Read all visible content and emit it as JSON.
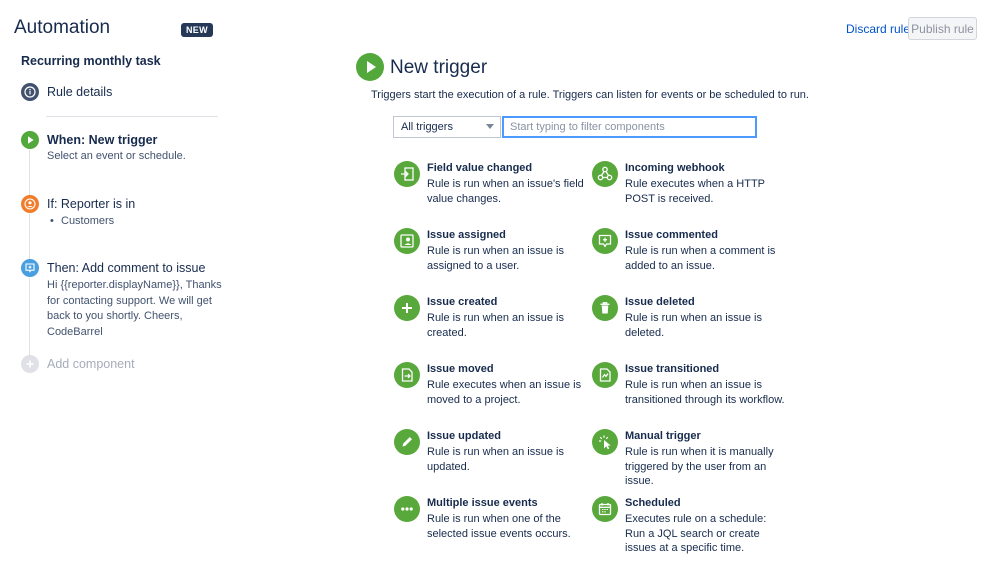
{
  "header": {
    "title": "Automation",
    "badge": "NEW",
    "discard_label": "Discard rule",
    "publish_label": "Publish rule"
  },
  "sidebar": {
    "rule_name": "Recurring monthly task",
    "rule_details_label": "Rule details",
    "steps": [
      {
        "title": "When: New trigger",
        "subtitle": "Select an event or schedule.",
        "color": "#52a83b",
        "icon": "play-icon"
      },
      {
        "title": "If: Reporter is in",
        "subtitle": "Customers",
        "color": "#f07d2b",
        "icon": "user-icon"
      },
      {
        "title": "Then: Add comment to issue",
        "subtitle": "Hi {{reporter.displayName}}, Thanks for contacting support. We will get back to you shortly. Cheers, CodeBarrel",
        "color": "#4a9fe0",
        "icon": "comment-icon"
      }
    ],
    "add_component_label": "Add component"
  },
  "main": {
    "title": "New trigger",
    "description": "Triggers start the execution of a rule. Triggers can listen for events or be scheduled to run.",
    "filter_select_value": "All triggers",
    "filter_placeholder": "Start typing to filter components",
    "components": [
      {
        "name": "Field value changed",
        "description": "Rule is run when an issue's field value changes.",
        "icon": "field-change-icon"
      },
      {
        "name": "Incoming webhook",
        "description": "Rule executes when a HTTP POST is received.",
        "icon": "webhook-icon"
      },
      {
        "name": "Issue assigned",
        "description": "Rule is run when an issue is assigned to a user.",
        "icon": "assign-user-icon"
      },
      {
        "name": "Issue commented",
        "description": "Rule is run when a comment is added to an issue.",
        "icon": "comment-icon"
      },
      {
        "name": "Issue created",
        "description": "Rule is run when an issue is created.",
        "icon": "plus-icon"
      },
      {
        "name": "Issue deleted",
        "description": "Rule is run when an issue is deleted.",
        "icon": "trash-icon"
      },
      {
        "name": "Issue moved",
        "description": "Rule executes when an issue is moved to a project.",
        "icon": "move-icon"
      },
      {
        "name": "Issue transitioned",
        "description": "Rule is run when an issue is transitioned through its workflow.",
        "icon": "transition-icon"
      },
      {
        "name": "Issue updated",
        "description": "Rule is run when an issue is updated.",
        "icon": "pencil-icon"
      },
      {
        "name": "Manual trigger",
        "description": "Rule is run when it is manually triggered by the user from an issue.",
        "icon": "cursor-click-icon"
      },
      {
        "name": "Multiple issue events",
        "description": "Rule is run when one of the selected issue events occurs.",
        "icon": "ellipsis-icon"
      },
      {
        "name": "Scheduled",
        "description": "Executes rule on a schedule: Run a JQL search or create issues at a specific time.",
        "icon": "calendar-icon"
      }
    ]
  },
  "colors": {
    "accent_green": "#52a83b",
    "link_blue": "#0052cc",
    "focus_blue": "#4c9aff",
    "badge_dark": "#253858"
  }
}
